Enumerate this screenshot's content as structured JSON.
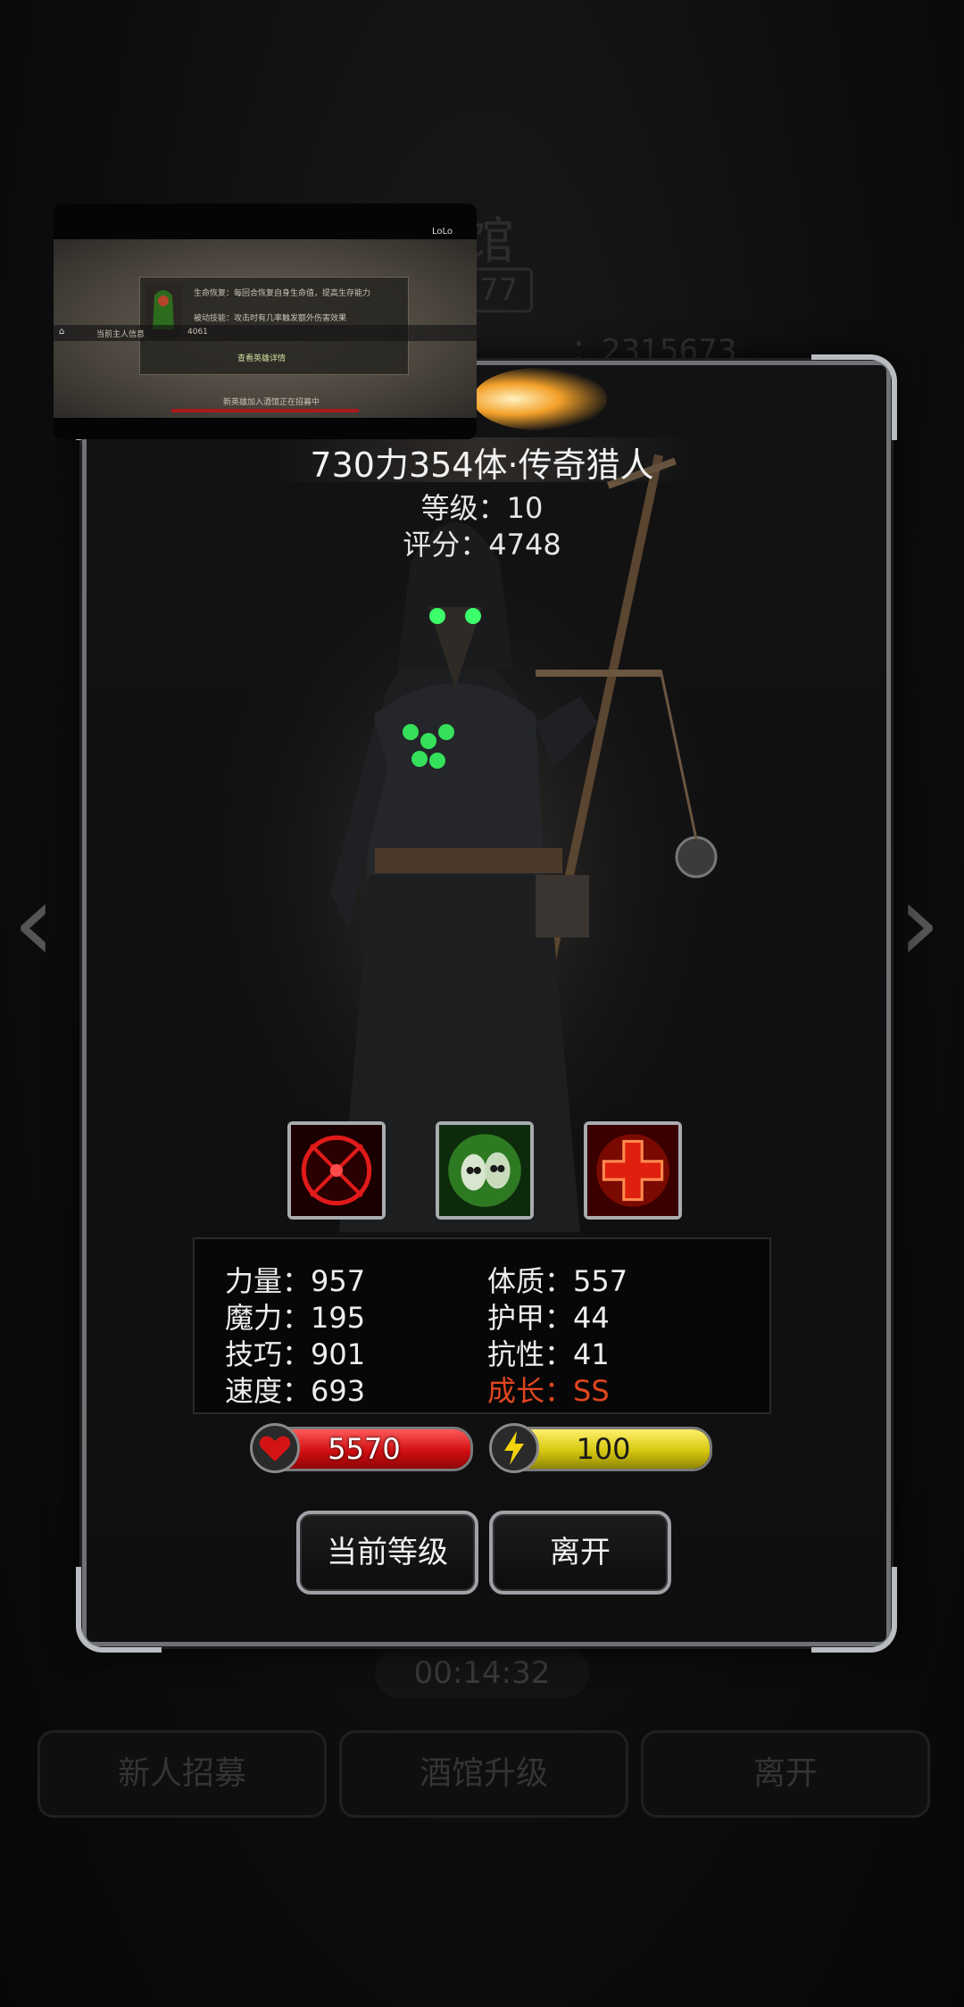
{
  "background": {
    "title": "馆",
    "count": "77",
    "id_text": "：2315673",
    "timer": "00:14:32",
    "buttons": [
      "新人招募",
      "酒馆升级",
      "离开"
    ]
  },
  "hero": {
    "name": "730力354体·传奇猎人",
    "level": "等级：10",
    "score": "评分：4748",
    "skills": [
      "crosshair-skill-icon",
      "ghost-skull-skill-icon",
      "red-cross-skill-icon"
    ]
  },
  "stats": {
    "strength": "力量：957",
    "constitution": "体质：557",
    "magic": "魔力：195",
    "armor": "护甲：44",
    "skill": "技巧：901",
    "resistance": "抗性：41",
    "speed": "速度：693",
    "growth": "成长：SS"
  },
  "resources": {
    "hp": "5570",
    "hp_fill": 1.0,
    "energy": "100",
    "energy_fill": 1.0
  },
  "buttons": {
    "current_level": "当前等级",
    "leave": "离开"
  },
  "pip": {
    "top_right": "LoLo",
    "chat_name": "当前主人信息",
    "chat_value": "4061",
    "line1": "生命恢复：每回合恢复自身生命值，提高生存能力",
    "line2": "被动技能：攻击时有几率触发额外伤害效果",
    "button": "查看英雄详情",
    "bottom": "新英雄加入酒馆正在招募中"
  },
  "colors": {
    "growth": "#e0461f",
    "hp": "#d10f12",
    "energy": "#d6c80f",
    "frame": "#b9bcc0"
  }
}
